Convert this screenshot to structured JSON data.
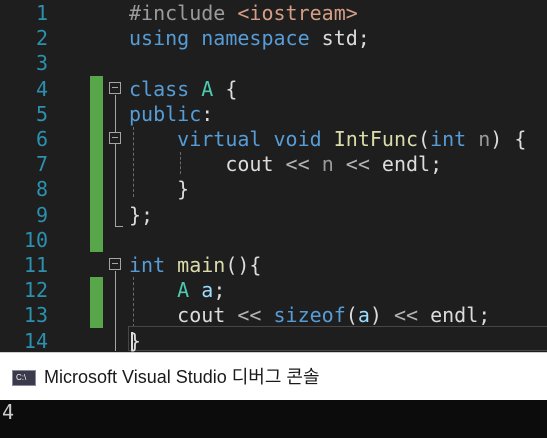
{
  "editor": {
    "lines": [
      {
        "number": "1",
        "tokens": [
          [
            "#include ",
            "#9b9b9b"
          ],
          [
            "<iostream>",
            "#d69d85"
          ]
        ]
      },
      {
        "number": "2",
        "tokens": [
          [
            "using",
            "#569cd6"
          ],
          [
            " ",
            "#dcdcdc"
          ],
          [
            "namespace",
            "#569cd6"
          ],
          [
            " std;",
            "#dcdcdc"
          ]
        ]
      },
      {
        "number": "3",
        "tokens": []
      },
      {
        "number": "4",
        "tokens": [
          [
            "class",
            "#569cd6"
          ],
          [
            " ",
            "#dcdcdc"
          ],
          [
            "A",
            "#4ec9b0"
          ],
          [
            " {",
            "#dcdcdc"
          ]
        ]
      },
      {
        "number": "5",
        "tokens": [
          [
            "public",
            "#569cd6"
          ],
          [
            ":",
            "#dcdcdc"
          ]
        ]
      },
      {
        "number": "6",
        "tokens": [
          [
            "    ",
            "#dcdcdc"
          ],
          [
            "virtual",
            "#569cd6"
          ],
          [
            " ",
            "#dcdcdc"
          ],
          [
            "void",
            "#569cd6"
          ],
          [
            " ",
            "#dcdcdc"
          ],
          [
            "IntFunc",
            "#dcdcaa"
          ],
          [
            "(",
            "#dcdcdc"
          ],
          [
            "int",
            "#569cd6"
          ],
          [
            " ",
            "#dcdcdc"
          ],
          [
            "n",
            "#9a9a9a"
          ],
          [
            ") {",
            "#dcdcdc"
          ]
        ]
      },
      {
        "number": "7",
        "tokens": [
          [
            "        cout ",
            "#dcdcdc"
          ],
          [
            "<<",
            "#b4b4b4"
          ],
          [
            " ",
            "#dcdcdc"
          ],
          [
            "n",
            "#9a9a9a"
          ],
          [
            " ",
            "#dcdcdc"
          ],
          [
            "<<",
            "#b4b4b4"
          ],
          [
            " endl;",
            "#dcdcdc"
          ]
        ]
      },
      {
        "number": "8",
        "tokens": [
          [
            "    }",
            "#dcdcdc"
          ]
        ]
      },
      {
        "number": "9",
        "tokens": [
          [
            "};",
            "#dcdcdc"
          ]
        ]
      },
      {
        "number": "10",
        "tokens": []
      },
      {
        "number": "11",
        "tokens": [
          [
            "int",
            "#569cd6"
          ],
          [
            " ",
            "#dcdcdc"
          ],
          [
            "main",
            "#dcdcaa"
          ],
          [
            "(){",
            "#dcdcdc"
          ]
        ]
      },
      {
        "number": "12",
        "tokens": [
          [
            "    ",
            "#dcdcdc"
          ],
          [
            "A",
            "#4ec9b0"
          ],
          [
            " ",
            "#dcdcdc"
          ],
          [
            "a",
            "#9cdcfe"
          ],
          [
            ";",
            "#dcdcdc"
          ]
        ]
      },
      {
        "number": "13",
        "tokens": [
          [
            "    cout ",
            "#dcdcdc"
          ],
          [
            "<<",
            "#b4b4b4"
          ],
          [
            " ",
            "#dcdcdc"
          ],
          [
            "sizeof",
            "#569cd6"
          ],
          [
            "(",
            "#dcdcdc"
          ],
          [
            "a",
            "#9cdcfe"
          ],
          [
            ") ",
            "#dcdcdc"
          ],
          [
            "<<",
            "#b4b4b4"
          ],
          [
            " endl;",
            "#dcdcdc"
          ]
        ]
      },
      {
        "number": "14",
        "tokens": [
          [
            "}",
            "#dcdcdc"
          ]
        ]
      }
    ]
  },
  "console": {
    "icon_label": "C:\\",
    "title": "Microsoft Visual Studio 디버그 콘솔",
    "output": "4"
  }
}
